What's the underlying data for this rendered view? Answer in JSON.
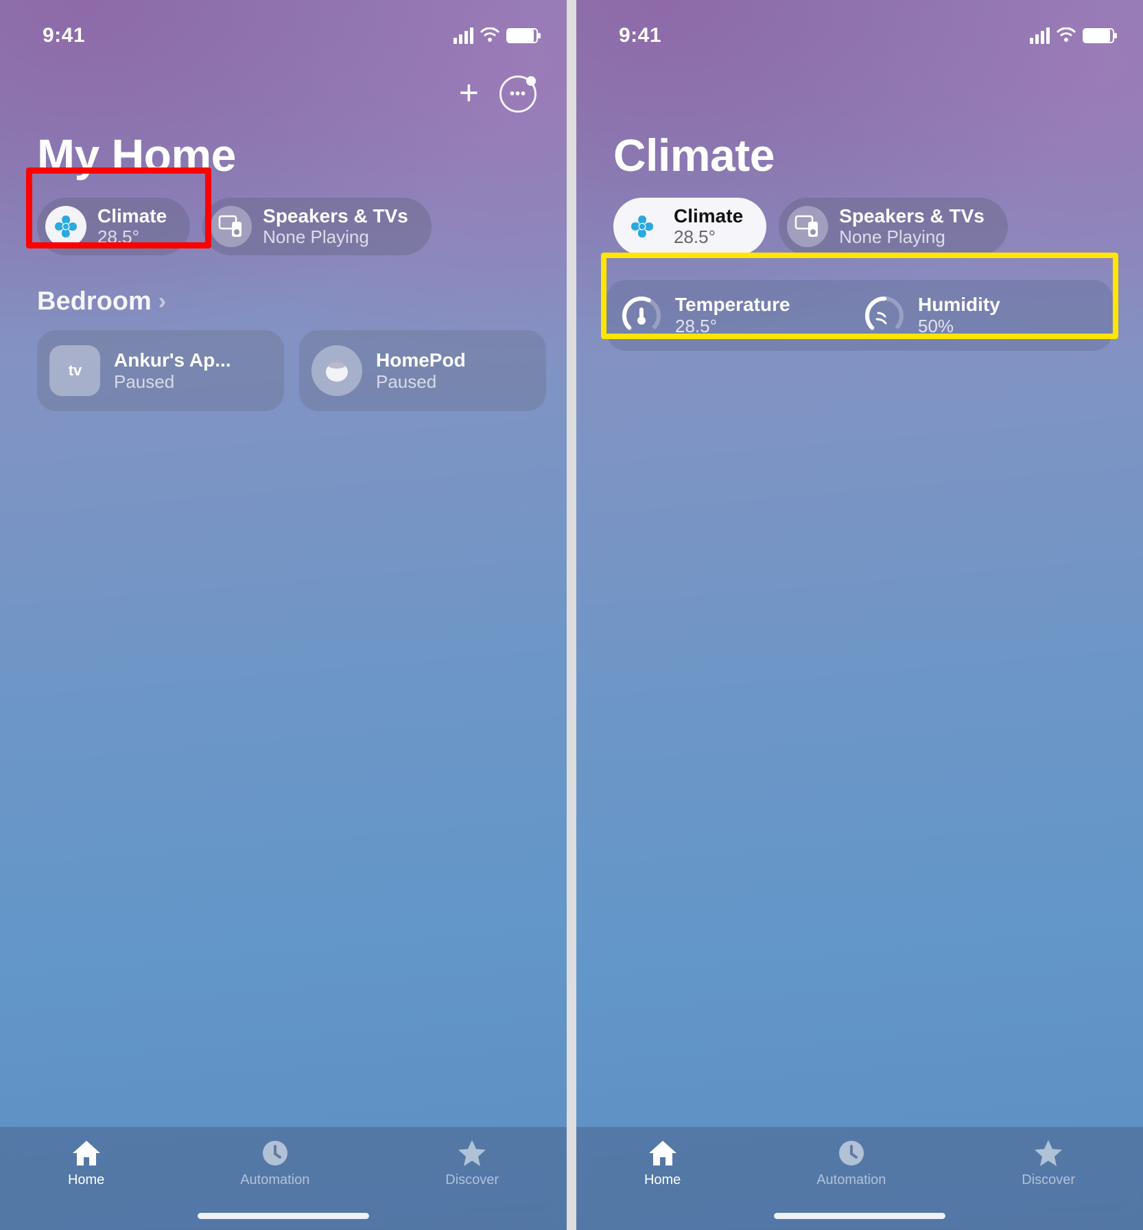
{
  "status": {
    "time": "9:41"
  },
  "left": {
    "title": "My Home",
    "chips": {
      "climate": {
        "label": "Climate",
        "value": "28.5°"
      },
      "speakers": {
        "label": "Speakers & TVs",
        "value": "None Playing"
      }
    },
    "room": {
      "name": "Bedroom",
      "cards": {
        "appletv": {
          "title": "Ankur's Ap...",
          "status": "Paused",
          "badge": "tv"
        },
        "homepod": {
          "title": "HomePod",
          "status": "Paused"
        }
      }
    }
  },
  "right": {
    "title": "Climate",
    "chips": {
      "climate": {
        "label": "Climate",
        "value": "28.5°"
      },
      "speakers": {
        "label": "Speakers & TVs",
        "value": "None Playing"
      }
    },
    "sensors": {
      "temperature": {
        "label": "Temperature",
        "value": "28.5°"
      },
      "humidity": {
        "label": "Humidity",
        "value": "50%"
      }
    }
  },
  "tabs": {
    "home": "Home",
    "automation": "Automation",
    "discover": "Discover"
  }
}
